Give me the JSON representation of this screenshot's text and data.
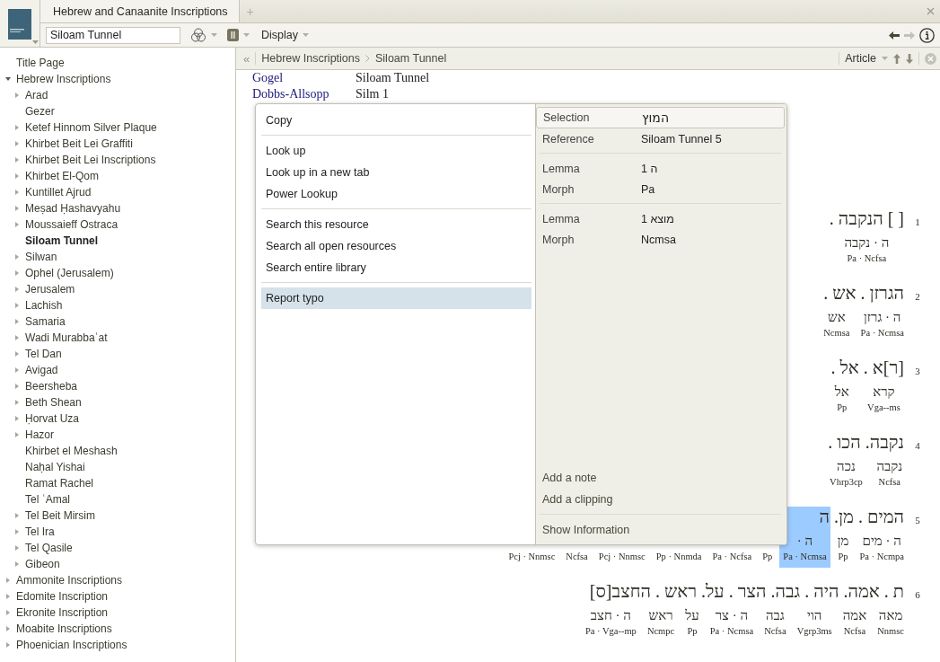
{
  "tabs": [
    {
      "label": "Hebrew and Canaanite Inscriptions",
      "selected": true
    }
  ],
  "new_tab": "+",
  "toolbar": {
    "search_value": "Siloam Tunnel",
    "display": "Display"
  },
  "nav": [
    {
      "kind": "back",
      "disabled": false
    },
    {
      "kind": "forward",
      "disabled": true
    }
  ],
  "sidebar": {
    "items": [
      {
        "label": "Title Page",
        "selected": false
      },
      {
        "label": "Hebrew Inscriptions",
        "selected": false,
        "expanded": true,
        "children": [
          {
            "label": "Arad",
            "selected": false,
            "expanded": false
          },
          {
            "label": "Gezer",
            "selected": false
          },
          {
            "label": "Ketef Hinnom Silver Plaque",
            "selected": false,
            "expanded": false
          },
          {
            "label": "Khirbet Beit Lei Graffiti",
            "selected": false,
            "expanded": false
          },
          {
            "label": "Khirbet Beit Lei Inscriptions",
            "selected": false,
            "expanded": false
          },
          {
            "label": "Khirbet El-Qom",
            "selected": false,
            "expanded": false
          },
          {
            "label": "Kuntillet Ajrud",
            "selected": false,
            "expanded": false
          },
          {
            "label": "Meṣad Ḥashavyahu",
            "selected": false,
            "expanded": false
          },
          {
            "label": "Moussaieff Ostraca",
            "selected": false,
            "expanded": false
          },
          {
            "label": "Siloam Tunnel",
            "selected": true
          },
          {
            "label": "Silwan",
            "selected": false,
            "expanded": false
          },
          {
            "label": "Ophel (Jerusalem)",
            "selected": false,
            "expanded": false
          },
          {
            "label": "Jerusalem",
            "selected": false,
            "expanded": false
          },
          {
            "label": "Lachish",
            "selected": false,
            "expanded": false
          },
          {
            "label": "Samaria",
            "selected": false,
            "expanded": false
          },
          {
            "label": "Wadi Murabbaʿat",
            "selected": false,
            "expanded": false
          },
          {
            "label": "Tel Dan",
            "selected": false,
            "expanded": false
          },
          {
            "label": "Avigad",
            "selected": false,
            "expanded": false
          },
          {
            "label": "Beersheba",
            "selected": false,
            "expanded": false
          },
          {
            "label": "Beth Shean",
            "selected": false,
            "expanded": false
          },
          {
            "label": "Ḥorvat Uza",
            "selected": false,
            "expanded": false
          },
          {
            "label": "Hazor",
            "selected": false,
            "expanded": false
          },
          {
            "label": "Khirbet el Meshash",
            "selected": false
          },
          {
            "label": "Naḥal Yishai",
            "selected": false
          },
          {
            "label": "Ramat Rachel",
            "selected": false
          },
          {
            "label": "Tel ʿAmal",
            "selected": false
          },
          {
            "label": "Tel Beit Mirsim",
            "selected": false,
            "expanded": false
          },
          {
            "label": "Tel Ira",
            "selected": false,
            "expanded": false
          },
          {
            "label": "Tel Qasile",
            "selected": false,
            "expanded": false
          },
          {
            "label": "Gibeon",
            "selected": false,
            "expanded": false
          }
        ]
      },
      {
        "label": "Ammonite Inscriptions",
        "selected": false,
        "expanded": false
      },
      {
        "label": "Edomite Inscription",
        "selected": false,
        "expanded": false
      },
      {
        "label": "Ekronite Inscription",
        "selected": false,
        "expanded": false
      },
      {
        "label": "Moabite Inscriptions",
        "selected": false,
        "expanded": false
      },
      {
        "label": "Phoenician Inscriptions",
        "selected": false,
        "expanded": false
      }
    ]
  },
  "breadcrumb": {
    "collapse": "«",
    "path": [
      "Hebrew Inscriptions",
      "Siloam Tunnel"
    ],
    "view": "Article"
  },
  "article": {
    "sigla": [
      {
        "name": "Gogel",
        "value": "Siloam Tunnel"
      },
      {
        "name": "Dobbs-Allsopp",
        "value": "Silm 1"
      }
    ],
    "lines": [
      {
        "number": "1",
        "text": "[ ] הנקבה .",
        "lemmas": [
          "ה · נקבה"
        ],
        "morphs": [
          {
            "text": "Pa · Ncfsa"
          }
        ]
      },
      {
        "number": "2",
        "text": "הגרזן . אש .",
        "lemmas": [
          "ה · גרזן",
          "אש"
        ],
        "morphs": [
          {
            "text": "Ncmsa"
          },
          {
            "text": "Pa · Ncmsa"
          }
        ]
      },
      {
        "number": "3",
        "text": "[ר]א . אל .",
        "lemmas": [
          "קרא",
          "אל"
        ],
        "morphs": [
          {
            "text": "Pp"
          },
          {
            "text": "Vga--ms"
          }
        ]
      },
      {
        "number": "4",
        "text": "נקבה. הכו .",
        "lemmas": [
          "נקבה",
          "נכה"
        ],
        "morphs": [
          {
            "text": "Vhrp3cp"
          },
          {
            "text": "Ncfsa"
          }
        ]
      },
      {
        "number": "5",
        "text": "המים . מן. ה",
        "lemmas": [
          "ה · מים",
          "מן",
          "ה ·"
        ],
        "morphs": [
          {
            "text": "Pcj · Nnmsc",
            "selected": false
          },
          {
            "text": "Ncfsa",
            "selected": false
          },
          {
            "text": "Pcj · Nnmsc",
            "selected": false
          },
          {
            "text": "Pp · Nnmda",
            "selected": false
          },
          {
            "text": "Pa · Ncfsa",
            "selected": false
          },
          {
            "text": "Pp",
            "selected": false
          },
          {
            "text": "Pa · Ncmsa",
            "selected": true
          },
          {
            "text": "Pp",
            "selected": false
          },
          {
            "text": "Pa · Ncmpa",
            "selected": false
          }
        ]
      },
      {
        "number": "6",
        "text": "ת . אמה. היה . גבה. הצר . על. ראש . החצב[ס]",
        "lemmas": [
          "מאה",
          "אמה",
          "הוי",
          "גבה",
          "ה · צר",
          "על",
          "ראש",
          "ה · חצב"
        ],
        "morphs": [
          {
            "text": "Pa · Vga--mp"
          },
          {
            "text": "Ncmpc"
          },
          {
            "text": "Pp"
          },
          {
            "text": "Pa · Ncmsa"
          },
          {
            "text": "Ncfsa"
          },
          {
            "text": "Vgrp3ms"
          },
          {
            "text": "Ncfsa"
          },
          {
            "text": "Nnmsc"
          }
        ]
      }
    ]
  },
  "context_menu": {
    "groups": [
      [
        {
          "label": "Copy",
          "selected": false
        }
      ],
      [
        {
          "label": "Look up",
          "selected": false
        },
        {
          "label": "Look up in a new tab",
          "selected": false
        },
        {
          "label": "Power Lookup",
          "selected": false
        }
      ],
      [
        {
          "label": "Search this resource",
          "selected": false
        },
        {
          "label": "Search all open resources",
          "selected": false
        },
        {
          "label": "Search entire library",
          "selected": false
        }
      ],
      [
        {
          "label": "Report typo",
          "selected": true
        }
      ]
    ],
    "info": {
      "selection": {
        "label": "Selection",
        "value": "המוץ"
      },
      "groups": [
        [
          {
            "label": "Reference",
            "value": "Siloam Tunnel 5"
          }
        ],
        [
          {
            "label": "Lemma",
            "value": "ה 1"
          },
          {
            "label": "Morph",
            "value": "Pa"
          }
        ],
        [
          {
            "label": "Lemma",
            "value": "מוצא 1"
          },
          {
            "label": "Morph",
            "value": "Ncmsa"
          }
        ]
      ]
    },
    "bottom_groups": [
      [
        {
          "label": "Add a note"
        },
        {
          "label": "Add a clipping"
        }
      ],
      [
        {
          "label": "Show Information"
        }
      ]
    ]
  }
}
